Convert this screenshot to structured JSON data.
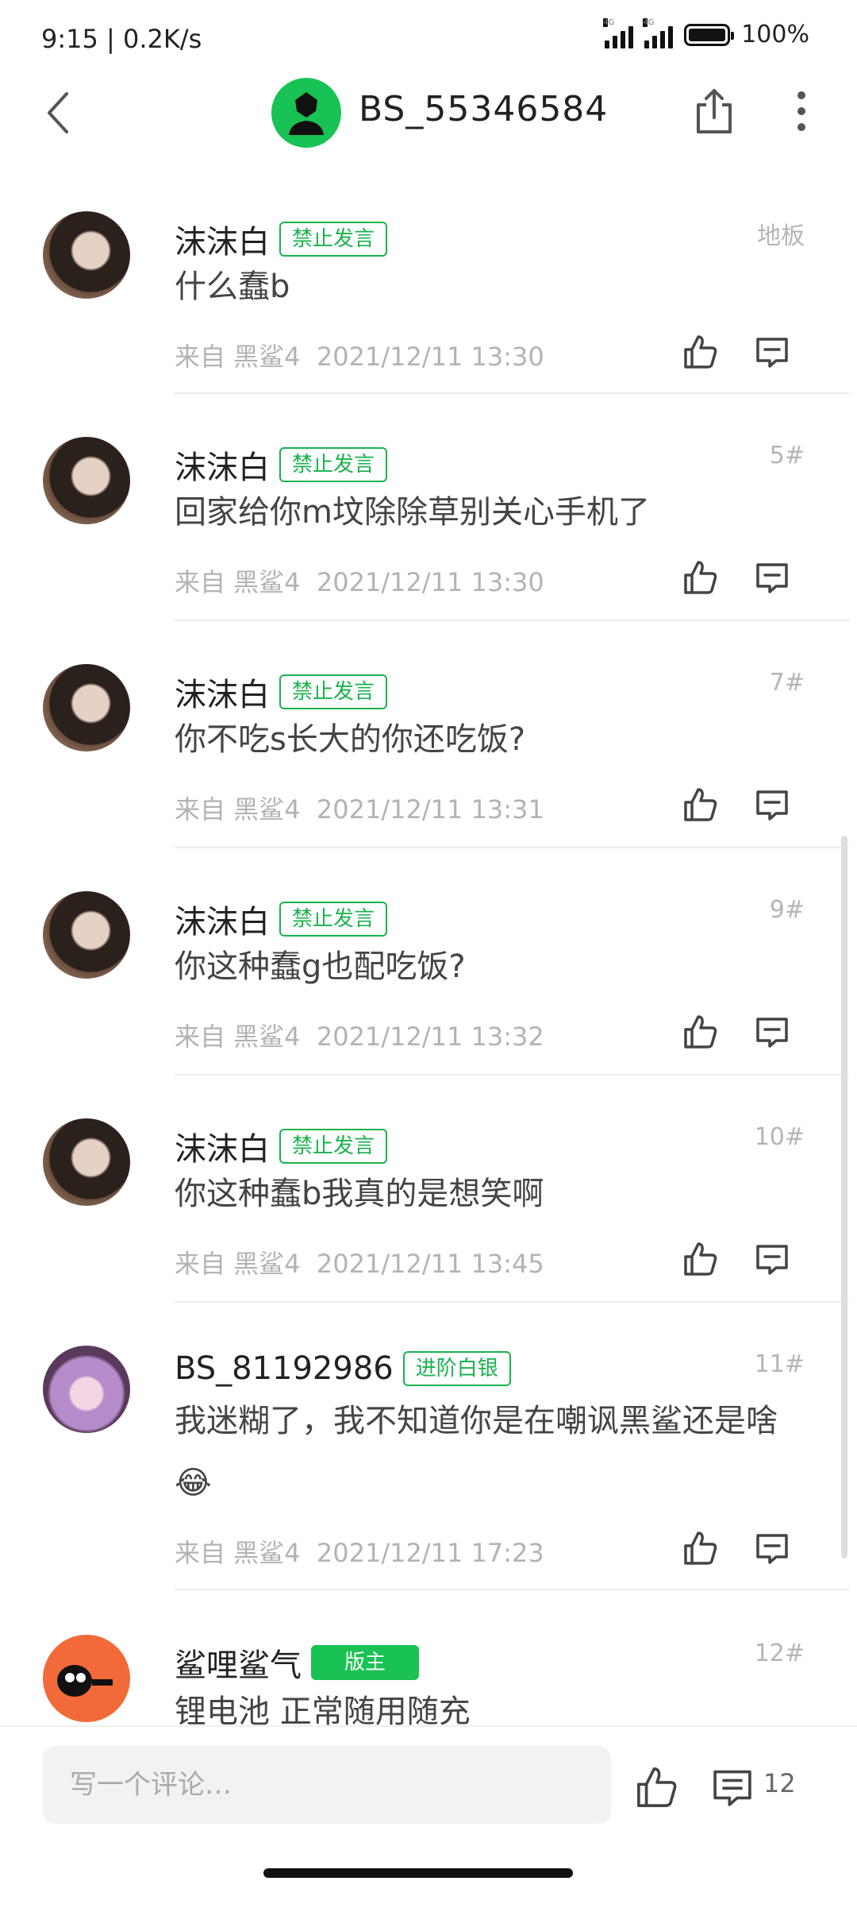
{
  "status_bar": {
    "time": "9:15 | 0.2K/s",
    "network": "4G",
    "battery": "100%",
    "battery_level": 1.0
  },
  "header": {
    "title": "BS_55346584"
  },
  "comments": [
    {
      "username": "沫沫白",
      "badge": "禁止发言",
      "floor": "地板",
      "text": "什么蠢b",
      "source": "来自 黑鲨4",
      "time": "2021/12/11 13:30"
    },
    {
      "username": "沫沫白",
      "badge": "禁止发言",
      "floor": "5#",
      "text": "回家给你m坟除除草别关心手机了",
      "source": "来自 黑鲨4",
      "time": "2021/12/11 13:30"
    },
    {
      "username": "沫沫白",
      "badge": "禁止发言",
      "floor": "7#",
      "text": "你不吃s长大的你还吃饭?",
      "source": "来自 黑鲨4",
      "time": "2021/12/11 13:31"
    },
    {
      "username": "沫沫白",
      "badge": "禁止发言",
      "floor": "9#",
      "text": "你这种蠢g也配吃饭?",
      "source": "来自 黑鲨4",
      "time": "2021/12/11 13:32"
    },
    {
      "username": "沫沫白",
      "badge": "禁止发言",
      "floor": "10#",
      "text": "你这种蠢b我真的是想笑啊",
      "source": "来自 黑鲨4",
      "time": "2021/12/11 13:45"
    },
    {
      "username": "BS_81192986",
      "badge": "进阶白银",
      "floor": "11#",
      "text": "我迷糊了，我不知道你是在嘲讽黑鲨还是啥😂",
      "source": "来自 黑鲨4",
      "time": "2021/12/11 17:23"
    },
    {
      "username": "鲨哩鲨气",
      "badge": "版主",
      "floor": "12#",
      "text": "锂电池 正常随用随充"
    }
  ],
  "bottom_bar": {
    "placeholder": "写一个评论…",
    "comment_count": "12"
  },
  "colors": {
    "accent": "#19c254",
    "badge_green": "#19b24e",
    "meta_gray": "#b3b3b3"
  },
  "icons": [
    "back-arrow-icon",
    "share-icon",
    "more-vertical-icon",
    "thumbs-up-icon",
    "comment-icon"
  ]
}
